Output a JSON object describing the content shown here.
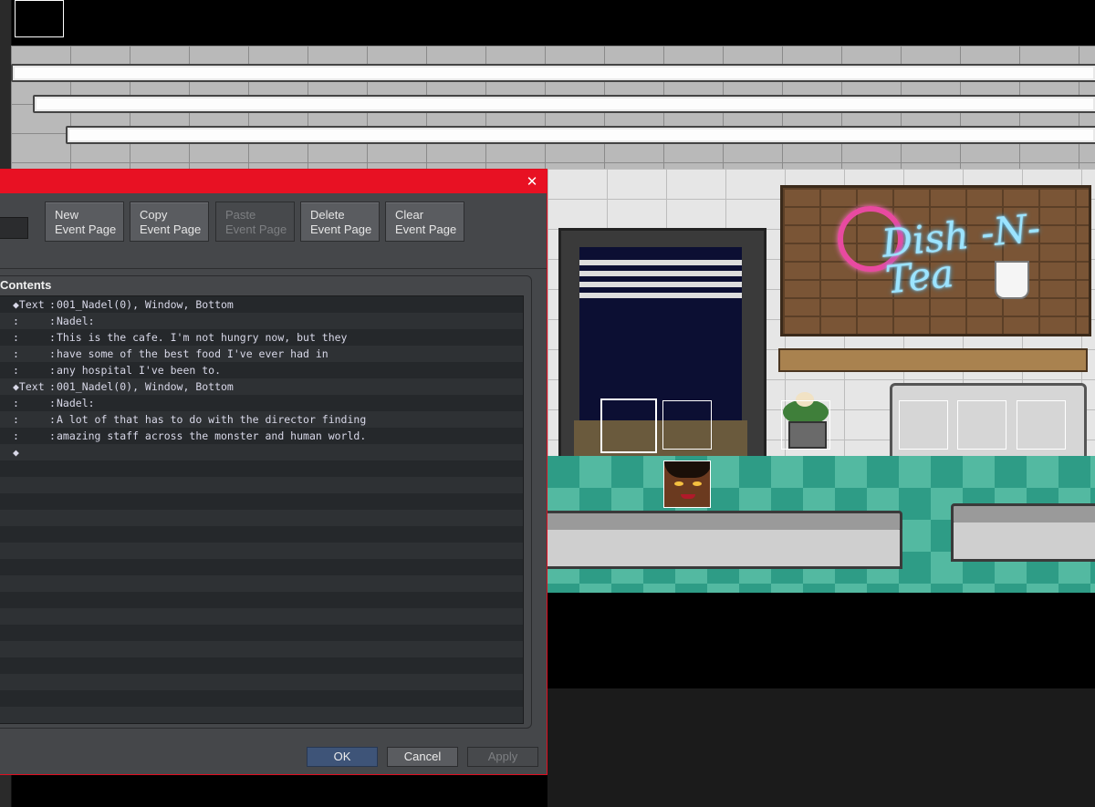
{
  "dialog": {
    "close_glyph": "✕",
    "toolbar": {
      "new_page": [
        "New",
        "Event Page"
      ],
      "copy_page": [
        "Copy",
        "Event Page"
      ],
      "paste_page": [
        "Paste",
        "Event Page"
      ],
      "delete_page": [
        "Delete",
        "Event Page"
      ],
      "clear_page": [
        "Clear",
        "Event Page"
      ]
    },
    "contents_label": "Contents",
    "commands": [
      {
        "cmd": "◆Text",
        "sep": ":",
        "text": "001_Nadel(0), Window, Bottom"
      },
      {
        "cmd": ":",
        "sep": ":",
        "text": "Nadel:"
      },
      {
        "cmd": ":",
        "sep": ":",
        "text": "This is the cafe. I'm not hungry now, but they"
      },
      {
        "cmd": ":",
        "sep": ":",
        "text": "have some of the best food I've ever had in"
      },
      {
        "cmd": ":",
        "sep": ":",
        "text": "any hospital I've been to."
      },
      {
        "cmd": "◆Text",
        "sep": ":",
        "text": "001_Nadel(0), Window, Bottom"
      },
      {
        "cmd": ":",
        "sep": ":",
        "text": "Nadel:"
      },
      {
        "cmd": ":",
        "sep": ":",
        "text": "A lot of that has to do with the director finding"
      },
      {
        "cmd": ":",
        "sep": ":",
        "text": "amazing staff across the monster and human world."
      },
      {
        "cmd": "◆",
        "sep": "",
        "text": ""
      }
    ],
    "buttons": {
      "ok": "OK",
      "cancel": "Cancel",
      "apply": "Apply"
    }
  },
  "map": {
    "sign_text": "Dish -N-Tea"
  },
  "colors": {
    "titlebar": "#e81123",
    "dialog_bg": "#45474a",
    "list_bg": "#2a2d30",
    "ok_button": "#3e5478"
  }
}
